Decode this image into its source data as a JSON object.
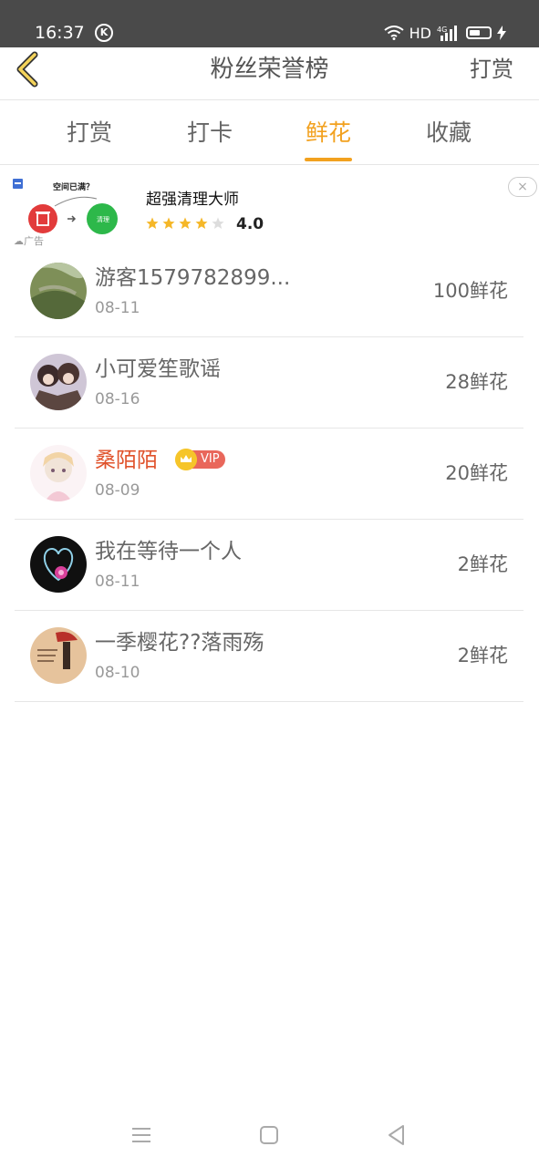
{
  "status_bar": {
    "time": "16:37",
    "k_badge": "K",
    "network_hd": "HD",
    "network_4g": "4G"
  },
  "header": {
    "title": "粉丝荣誉榜",
    "right_action": "打赏"
  },
  "tabs": [
    {
      "label": "打赏",
      "active": false
    },
    {
      "label": "打卡",
      "active": false
    },
    {
      "label": "鲜花",
      "active": true
    },
    {
      "label": "收藏",
      "active": false
    }
  ],
  "ad": {
    "illustration_text": "空间已满？",
    "illustration_button": "清理",
    "title": "超强清理大师",
    "stars": 4,
    "rating": "4.0",
    "label": "广告",
    "close": "×"
  },
  "fans": [
    {
      "name": "游客1579782899...",
      "date": "08-11",
      "count": "100鲜花",
      "vip": false
    },
    {
      "name": "小可爱笙歌谣",
      "date": "08-16",
      "count": "28鲜花",
      "vip": false
    },
    {
      "name": "桑陌陌",
      "date": "08-09",
      "count": "20鲜花",
      "vip": true,
      "vip_label": "VIP"
    },
    {
      "name": "我在等待一个人",
      "date": "08-11",
      "count": "2鲜花",
      "vip": false
    },
    {
      "name": "一季樱花??落雨殇",
      "date": "08-10",
      "count": "2鲜花",
      "vip": false
    }
  ],
  "colors": {
    "accent": "#f2a11f",
    "vip_name": "#e0522b",
    "status_bar": "#4a4a4a"
  }
}
